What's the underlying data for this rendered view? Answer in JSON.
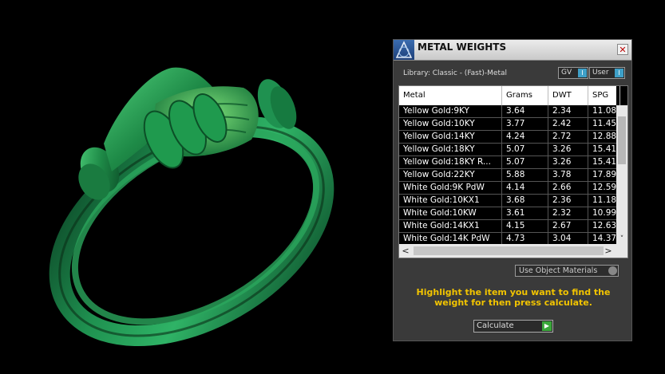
{
  "panel": {
    "title": "METAL WEIGHTS",
    "close_glyph": "✕",
    "library_label": "Library: Classic - (Fast)-Metal",
    "toggles": {
      "gv": "GV",
      "user": "User",
      "knob_glyph": "I"
    },
    "table": {
      "headers": [
        "Metal",
        "Grams",
        "DWT",
        "SPG"
      ],
      "rows": [
        [
          "Yellow Gold:9KY",
          "3.64",
          "2.34",
          "11.08"
        ],
        [
          "Yellow Gold:10KY",
          "3.77",
          "2.42",
          "11.45"
        ],
        [
          "Yellow Gold:14KY",
          "4.24",
          "2.72",
          "12.88"
        ],
        [
          "Yellow Gold:18KY",
          "5.07",
          "3.26",
          "15.41"
        ],
        [
          "Yellow Gold:18KY R...",
          "5.07",
          "3.26",
          "15.41"
        ],
        [
          "Yellow Gold:22KY",
          "5.88",
          "3.78",
          "17.89"
        ],
        [
          "White Gold:9K PdW",
          "4.14",
          "2.66",
          "12.59"
        ],
        [
          "White Gold:10KX1",
          "3.68",
          "2.36",
          "11.18"
        ],
        [
          "White Gold:10KW",
          "3.61",
          "2.32",
          "10.99"
        ],
        [
          "White Gold:14KX1",
          "4.15",
          "2.67",
          "12.63"
        ],
        [
          "White Gold:14K PdW",
          "4.73",
          "3.04",
          "14.37"
        ]
      ]
    },
    "scroll": {
      "down_glyph": "˅",
      "left_glyph": "<",
      "right_glyph": ">"
    },
    "object_materials_label": "Use Object Materials",
    "hint_text": "Highlight the item you want to find the weight for then press calculate.",
    "calculate_label": "Calculate",
    "calculate_arrow": "▶"
  },
  "colors": {
    "ring_green": "#1f8a4c",
    "hint_yellow": "#f2c400",
    "accent_blue": "#3fa0c8"
  }
}
